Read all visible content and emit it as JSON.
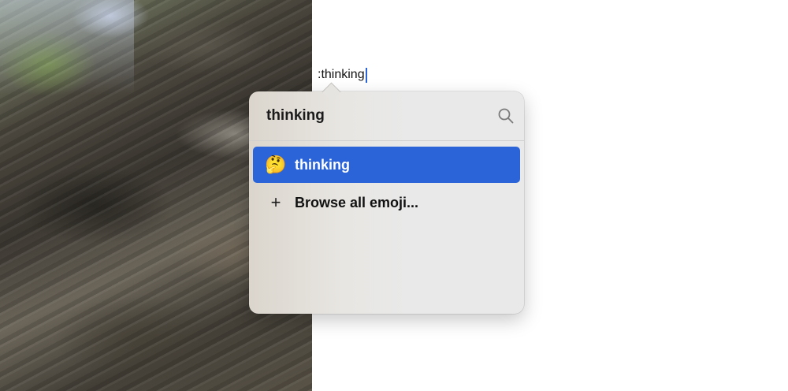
{
  "editor": {
    "typed_text": ":thinking"
  },
  "emoji_popover": {
    "search_query": "thinking",
    "results": [
      {
        "glyph": "🤔",
        "label": "thinking",
        "selected": true
      },
      {
        "glyph": "+",
        "label": "Browse all emoji...",
        "selected": false
      }
    ]
  },
  "colors": {
    "selection": "#2a64d8",
    "popover_bg": "#e9e9e9",
    "caret": "#2a64d8"
  },
  "icons": {
    "search": "search-icon",
    "browse": "plus-icon"
  }
}
